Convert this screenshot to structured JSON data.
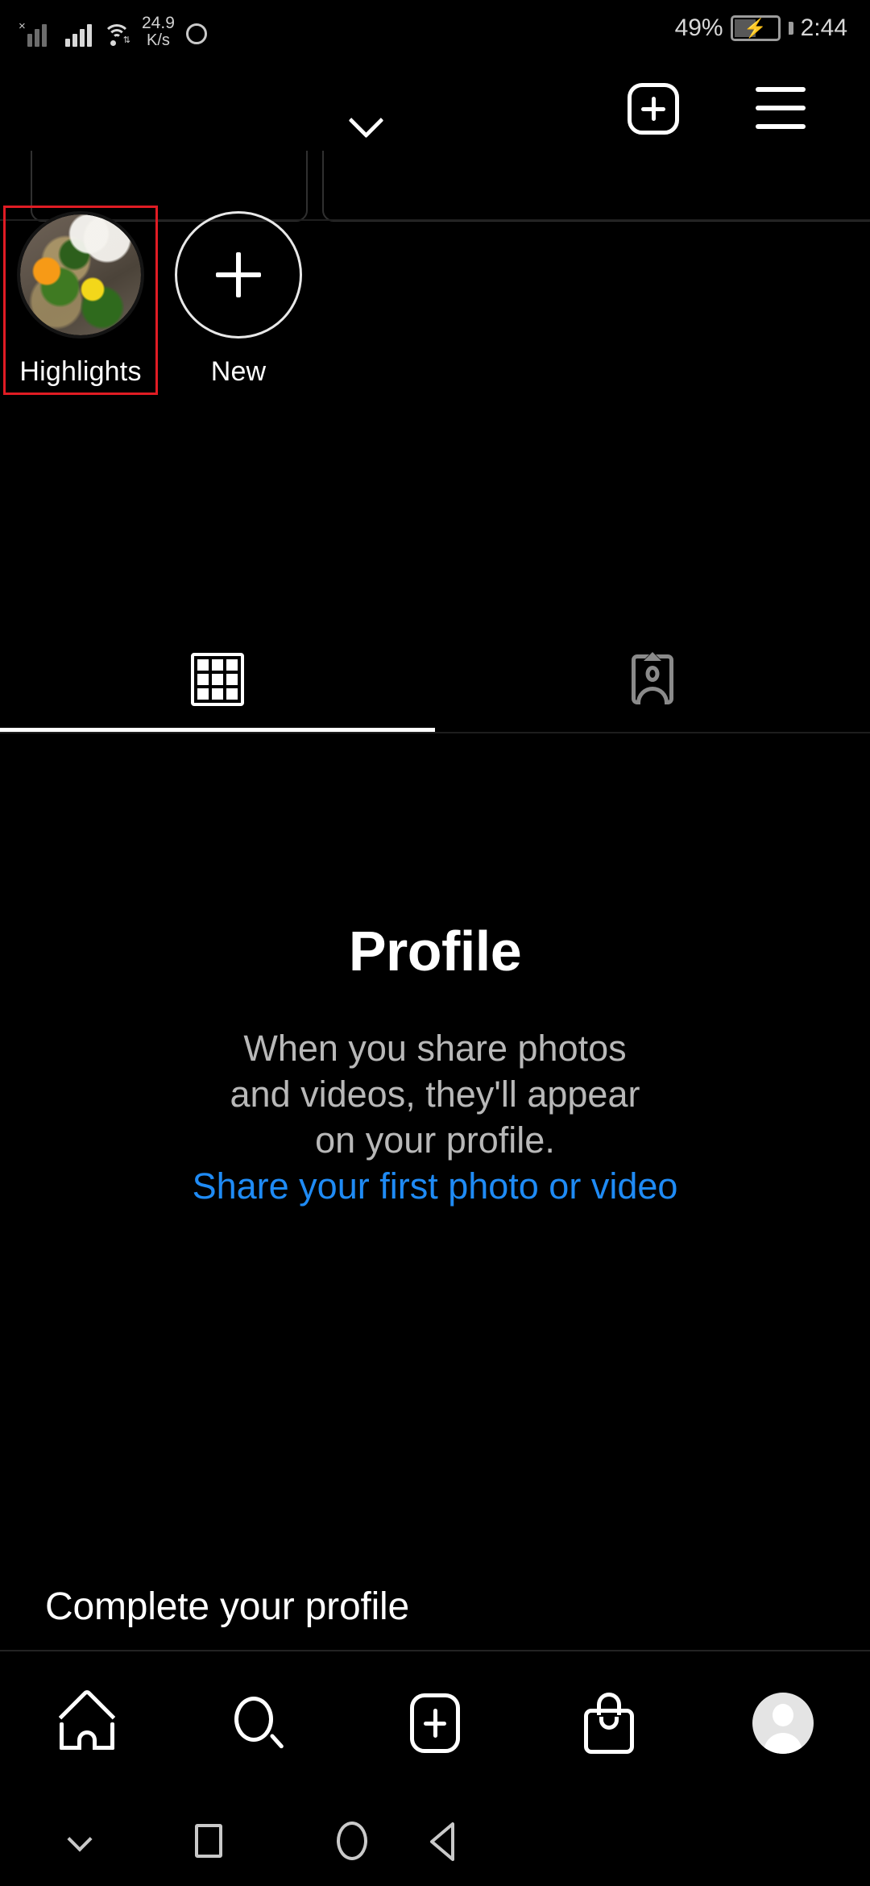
{
  "status_bar": {
    "network_speed_value": "24.9",
    "network_speed_unit": "K/s",
    "battery_percent": "49%",
    "clock": "2:44",
    "icons": {
      "signal_dim": "signal-bars-no-service-icon",
      "signal_bright": "signal-bars-icon",
      "wifi": "wifi-icon",
      "ring": "circle-indicator-icon",
      "battery": "battery-charging-icon"
    }
  },
  "top_nav": {
    "chevron_icon": "chevron-down-icon",
    "add_icon": "plus-square-icon",
    "menu_icon": "hamburger-menu-icon"
  },
  "highlights": {
    "items": [
      {
        "label": "Highlights",
        "selected": true,
        "thumbnail": "flower-pots-photo"
      },
      {
        "label": "New",
        "selected": false,
        "icon": "plus-icon"
      }
    ],
    "selection_color": "#e01c24"
  },
  "tabs": [
    {
      "id": "grid",
      "icon": "grid-icon",
      "active": true
    },
    {
      "id": "tagged",
      "icon": "person-card-icon",
      "active": false
    }
  ],
  "empty_state": {
    "title": "Profile",
    "line1": "When you share photos",
    "line2": "and videos, they'll appear",
    "line3": "on your profile.",
    "link": "Share your first photo or video",
    "link_color": "#1f8bf5"
  },
  "complete_profile": {
    "title": "Complete your profile"
  },
  "bottom_nav": [
    {
      "id": "home",
      "icon": "home-icon"
    },
    {
      "id": "search",
      "icon": "search-icon"
    },
    {
      "id": "create",
      "icon": "plus-square-icon"
    },
    {
      "id": "shop",
      "icon": "shopping-bag-icon"
    },
    {
      "id": "profile",
      "icon": "avatar-icon"
    }
  ],
  "android_nav": [
    {
      "id": "hide-keyboard",
      "icon": "chevron-down-icon"
    },
    {
      "id": "recents",
      "icon": "square-icon"
    },
    {
      "id": "home",
      "icon": "circle-icon"
    },
    {
      "id": "back",
      "icon": "triangle-left-icon"
    }
  ]
}
